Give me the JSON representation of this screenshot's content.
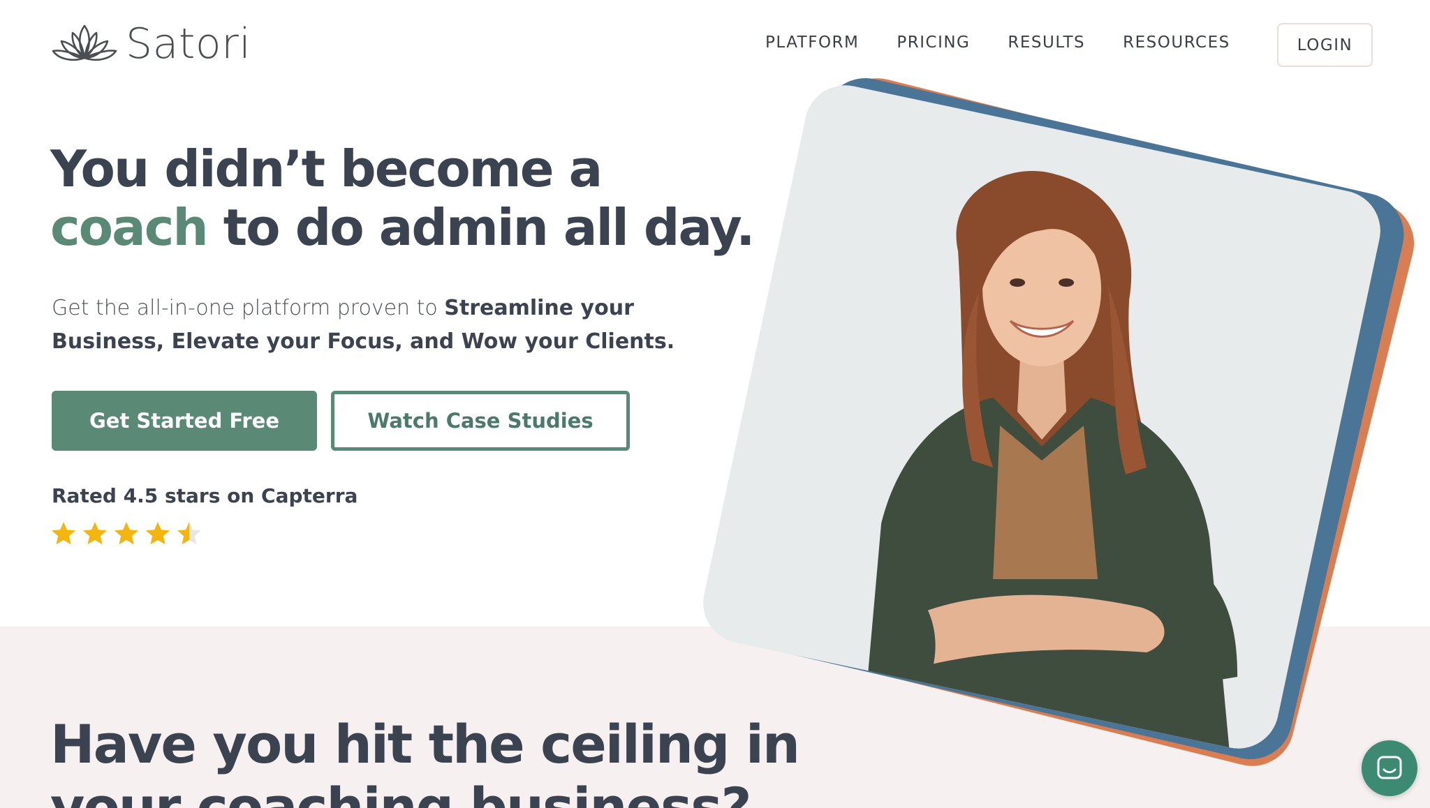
{
  "brand": {
    "name": "Satori"
  },
  "nav": {
    "items": [
      "PLATFORM",
      "PRICING",
      "RESULTS",
      "RESOURCES"
    ],
    "login_label": "LOGIN"
  },
  "hero": {
    "headline_line1": "You didn’t become a",
    "headline_accent": "coach",
    "headline_rest": " to do admin all day.",
    "subtext_plain": "Get the all-in-one platform proven to ",
    "subtext_bold": "Streamline your Business, Elevate your Focus, and Wow your Clients.",
    "cta_primary": "Get Started Free",
    "cta_secondary": "Watch Case Studies",
    "rating_text": "Rated 4.5 stars on Capterra",
    "rating_value": 4.5,
    "rating_max": 5
  },
  "section2": {
    "heading": "Have you hit the ceiling in your coaching business?"
  },
  "colors": {
    "brand_green": "#5a8a76",
    "text_dark": "#3c4350",
    "accent_orange": "#d97d52",
    "accent_blue": "#4b7596",
    "star_gold": "#f5b50f",
    "band_bg": "#f6f1f0"
  },
  "icons": {
    "logo": "lotus-icon",
    "chat": "chat-icon",
    "star": "star-icon"
  }
}
